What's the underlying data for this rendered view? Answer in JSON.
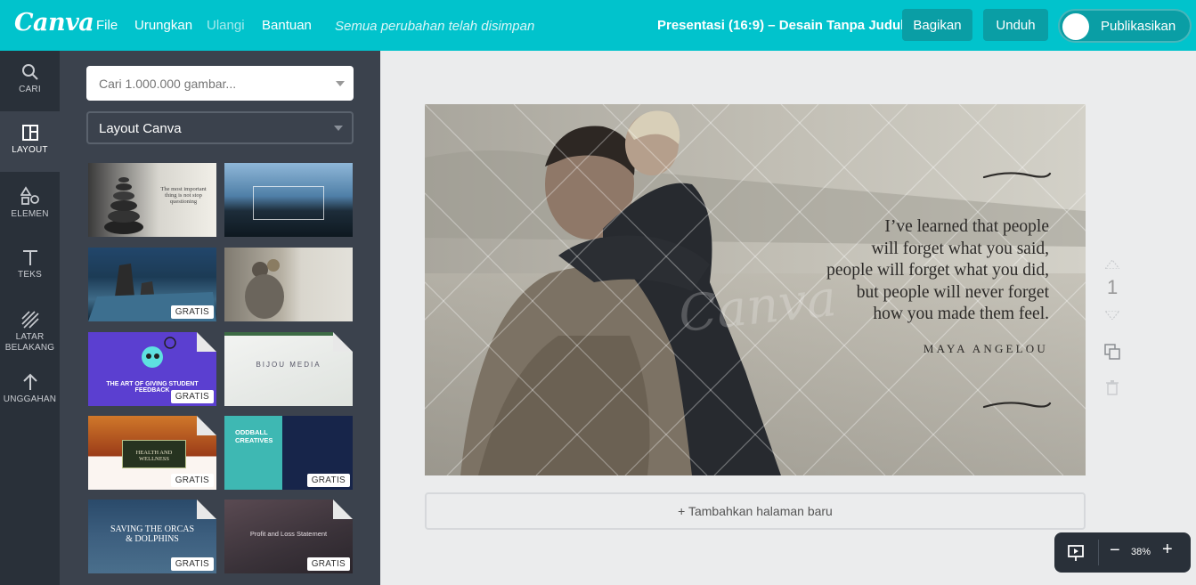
{
  "app": {
    "logo": "Canva"
  },
  "menu": {
    "file": "File",
    "undo": "Urungkan",
    "redo": "Ulangi",
    "help": "Bantuan"
  },
  "status": "Semua perubahan telah disimpan",
  "document": {
    "title": "Presentasi (16:9) – Desain Tanpa Judul"
  },
  "actions": {
    "share": "Bagikan",
    "download": "Unduh",
    "publish": "Publikasikan"
  },
  "rail": [
    {
      "label": "CARI",
      "icon": "search-icon"
    },
    {
      "label": "LAYOUT",
      "icon": "layout-icon"
    },
    {
      "label": "ELEMEN",
      "icon": "elements-icon"
    },
    {
      "label": "TEKS",
      "icon": "text-icon"
    },
    {
      "label": "LATAR BELAKANG",
      "icon": "background-icon"
    },
    {
      "label": "UNGGAHAN",
      "icon": "upload-icon"
    }
  ],
  "panel": {
    "search_placeholder": "Cari 1.000.000 gambar...",
    "layout_select": "Layout Canva",
    "thumbnails": [
      {
        "text": "The most important thing is not stop questioning",
        "badge": ""
      },
      {
        "text": "",
        "badge": ""
      },
      {
        "text": "",
        "badge": "GRATIS"
      },
      {
        "text": "",
        "badge": ""
      },
      {
        "text": "THE ART OF GIVING STUDENT FEEDBACK",
        "badge": "GRATIS"
      },
      {
        "text": "BIJOU MEDIA",
        "badge": ""
      },
      {
        "text": "HEALTH AND WELLNESS",
        "badge": "GRATIS"
      },
      {
        "text": "ODDBALL CREATIVES",
        "badge": "GRATIS"
      },
      {
        "text": "SAVING THE ORCAS & DOLPHINS",
        "badge": "GRATIS"
      },
      {
        "text": "Profit and Loss Statement",
        "badge": "GRATIS"
      }
    ]
  },
  "slide": {
    "quote_lines": [
      "I’ve learned that people",
      "will forget what you said,",
      "people will forget what you did,",
      "but people will never forget",
      "how you made them feel."
    ],
    "author": "MAYA ANGELOU",
    "watermark": "Canva"
  },
  "add_page": "+ Tambahkan halaman baru",
  "page_number": "1",
  "zoom": "38%",
  "colors": {
    "topbar": "#01c3cc",
    "button": "#0a9ea5",
    "rail": "#293039",
    "panel": "#3b424d"
  }
}
